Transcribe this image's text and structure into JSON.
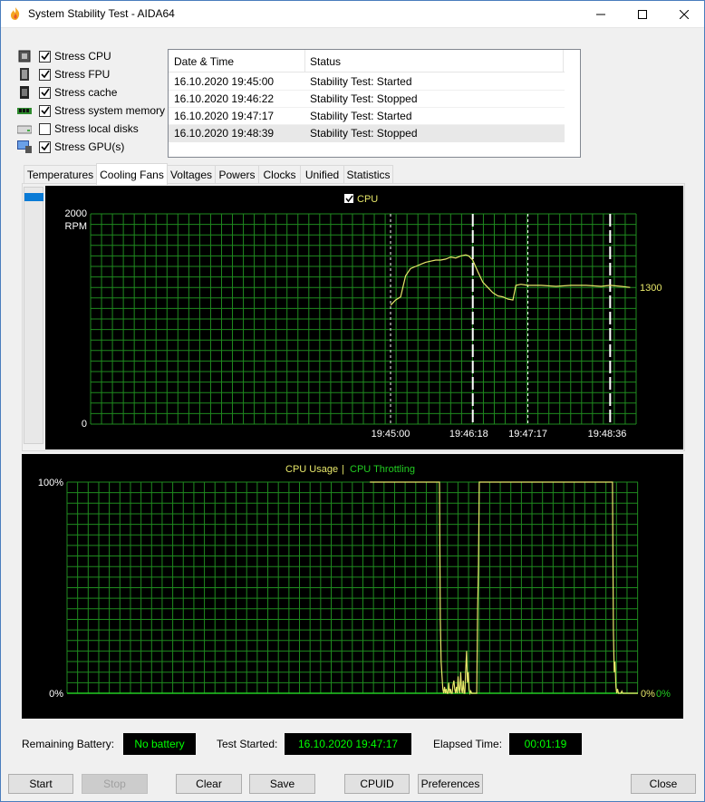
{
  "window": {
    "title": "System Stability Test - AIDA64"
  },
  "stress_options": [
    {
      "label": "Stress CPU",
      "checked": true,
      "icon": "cpu-chip-icon"
    },
    {
      "label": "Stress FPU",
      "checked": true,
      "icon": "fpu-chip-icon"
    },
    {
      "label": "Stress cache",
      "checked": true,
      "icon": "cache-chip-icon"
    },
    {
      "label": "Stress system memory",
      "checked": true,
      "icon": "memory-module-icon"
    },
    {
      "label": "Stress local disks",
      "checked": false,
      "icon": "disk-drive-icon"
    },
    {
      "label": "Stress GPU(s)",
      "checked": true,
      "icon": "monitor-gpu-icon"
    }
  ],
  "log": {
    "headers": [
      "Date & Time",
      "Status"
    ],
    "rows": [
      {
        "datetime": "16.10.2020 19:45:00",
        "status": "Stability Test: Started"
      },
      {
        "datetime": "16.10.2020 19:46:22",
        "status": "Stability Test: Stopped"
      },
      {
        "datetime": "16.10.2020 19:47:17",
        "status": "Stability Test: Started"
      },
      {
        "datetime": "16.10.2020 19:48:39",
        "status": "Stability Test: Stopped"
      }
    ]
  },
  "tabs": [
    {
      "label": "Temperatures",
      "active": false
    },
    {
      "label": "Cooling Fans",
      "active": true
    },
    {
      "label": "Voltages",
      "active": false
    },
    {
      "label": "Powers",
      "active": false
    },
    {
      "label": "Clocks",
      "active": false
    },
    {
      "label": "Unified",
      "active": false
    },
    {
      "label": "Statistics",
      "active": false
    }
  ],
  "chart_data": [
    {
      "type": "line",
      "legend": [
        "CPU"
      ],
      "legend_checked": true,
      "y_max_label": "2000",
      "y_unit": "RPM",
      "y_min_label": "0",
      "ylim": [
        0,
        2000
      ],
      "x_tick_labels": [
        "19:45:00",
        "19:46:18",
        "19:47:17",
        "19:48:36"
      ],
      "current_value_label": "1300",
      "series": [
        {
          "name": "CPU",
          "color": "#e8e86a",
          "points": [
            [
              "19:45:00",
              1130
            ],
            [
              "19:45:05",
              1180
            ],
            [
              "19:45:10",
              1210
            ],
            [
              "19:45:15",
              1410
            ],
            [
              "19:45:20",
              1480
            ],
            [
              "19:45:25",
              1500
            ],
            [
              "19:45:30",
              1520
            ],
            [
              "19:45:35",
              1540
            ],
            [
              "19:45:40",
              1550
            ],
            [
              "19:45:45",
              1560
            ],
            [
              "19:45:50",
              1560
            ],
            [
              "19:45:55",
              1570
            ],
            [
              "19:46:00",
              1590
            ],
            [
              "19:46:05",
              1580
            ],
            [
              "19:46:10",
              1600
            ],
            [
              "19:46:15",
              1610
            ],
            [
              "19:46:18",
              1600
            ],
            [
              "19:46:22",
              1560
            ],
            [
              "19:46:27",
              1450
            ],
            [
              "19:46:32",
              1350
            ],
            [
              "19:46:37",
              1300
            ],
            [
              "19:46:42",
              1250
            ],
            [
              "19:46:47",
              1220
            ],
            [
              "19:46:52",
              1210
            ],
            [
              "19:46:57",
              1190
            ],
            [
              "19:47:02",
              1180
            ],
            [
              "19:47:05",
              1320
            ],
            [
              "19:47:10",
              1330
            ],
            [
              "19:47:17",
              1320
            ],
            [
              "19:47:30",
              1320
            ],
            [
              "19:47:45",
              1310
            ],
            [
              "19:48:00",
              1320
            ],
            [
              "19:48:15",
              1320
            ],
            [
              "19:48:30",
              1310
            ],
            [
              "19:48:39",
              1320
            ],
            [
              "19:48:50",
              1310
            ],
            [
              "19:48:59",
              1300
            ]
          ]
        }
      ],
      "event_markers": [
        "19:45:00",
        "19:46:22",
        "19:47:17",
        "19:48:39"
      ],
      "grid": true
    },
    {
      "type": "line",
      "legend": [
        "CPU Usage",
        "CPU Throttling"
      ],
      "legend_colors": [
        "#e8e86a",
        "#22cc22"
      ],
      "y_max_label": "100%",
      "y_min_label": "0%",
      "ylim": [
        0,
        100
      ],
      "current_value_labels": [
        "0%",
        "0%"
      ],
      "series": [
        {
          "name": "CPU Usage",
          "color": "#e8e86a",
          "values": [
            0,
            0,
            0,
            0,
            0,
            0,
            0,
            0,
            0,
            0,
            0,
            0,
            0,
            0,
            0,
            0,
            0,
            0,
            0,
            0,
            0,
            0,
            0,
            0,
            0,
            0,
            0,
            0,
            0,
            0,
            0,
            0,
            0,
            0,
            0,
            0,
            0,
            0,
            0,
            0,
            0,
            0,
            0,
            0,
            0,
            0,
            0,
            0,
            0,
            0,
            0,
            0,
            0,
            0,
            0,
            0,
            0,
            0,
            0,
            0,
            0,
            0,
            0,
            0,
            0,
            0,
            0,
            0,
            0,
            0,
            0,
            0,
            0,
            0,
            0,
            0,
            0,
            0,
            0,
            0,
            0,
            0,
            0,
            0,
            0,
            0,
            0,
            0,
            0,
            0,
            0,
            0,
            0,
            0,
            0,
            0,
            0,
            0,
            0,
            0,
            0,
            0,
            0,
            0,
            0,
            0,
            0,
            0,
            0,
            0,
            0,
            0,
            0,
            0,
            0,
            0,
            0,
            0,
            0,
            0,
            0,
            0,
            0,
            0,
            0,
            0,
            0,
            0,
            0,
            0,
            0,
            0,
            0,
            0,
            0,
            0,
            0,
            0,
            0,
            0,
            0,
            0,
            0,
            0,
            0,
            0,
            0,
            0,
            0,
            0,
            0,
            0,
            0,
            0,
            0,
            0,
            0,
            0,
            0,
            0,
            0,
            0,
            0,
            0,
            0,
            0,
            0,
            0,
            0,
            0,
            0,
            0,
            0,
            0,
            0,
            0,
            0,
            0,
            0,
            0,
            0,
            0,
            0,
            0,
            0,
            0,
            0,
            0,
            0,
            0,
            0,
            0,
            0,
            0,
            0,
            0,
            0,
            0,
            0,
            0,
            0,
            0,
            0,
            0,
            0,
            0,
            0,
            0,
            0,
            0,
            0,
            0,
            0,
            0,
            0,
            0,
            0,
            0,
            0,
            0,
            0,
            0,
            0,
            0,
            0,
            0,
            0,
            0,
            0,
            0,
            0,
            0,
            0,
            0,
            0,
            0,
            0,
            0,
            0,
            0,
            0,
            0,
            0,
            0,
            0,
            0,
            0,
            0,
            0,
            0,
            0,
            0,
            0,
            0,
            0,
            0,
            0,
            0,
            0,
            0,
            0,
            0,
            0,
            0,
            0,
            0,
            0,
            0,
            0,
            0,
            0,
            0,
            0,
            0,
            0,
            0,
            0,
            0,
            0,
            0,
            0,
            0,
            0,
            0,
            0,
            0,
            0,
            0,
            0,
            0,
            0,
            0,
            0,
            0,
            0,
            0,
            0,
            0,
            0,
            0,
            0,
            0,
            0,
            0,
            0,
            0,
            0,
            0,
            0,
            0,
            0,
            0,
            0,
            0,
            0,
            0,
            0,
            0,
            0,
            0,
            0,
            0,
            0,
            0,
            0,
            0,
            0,
            0,
            0,
            0,
            0,
            0,
            0,
            0,
            0,
            0,
            0,
            0,
            0,
            0,
            0,
            0,
            0,
            0,
            0,
            0,
            0,
            0,
            0,
            0,
            2,
            8,
            0,
            100,
            100,
            100,
            100,
            100,
            100,
            100,
            100,
            100,
            100,
            100,
            100,
            100,
            100,
            100,
            100,
            100,
            100,
            100,
            100,
            100,
            100,
            100,
            100,
            100,
            100,
            100,
            100,
            100,
            100,
            100,
            100,
            100,
            100,
            100,
            100,
            100,
            100,
            100,
            100,
            100,
            100,
            100,
            100,
            100,
            100,
            100,
            100,
            100,
            100,
            100,
            100,
            100,
            100,
            100,
            100,
            100,
            100,
            100,
            100,
            100,
            100,
            100,
            100,
            100,
            100,
            100,
            100,
            100,
            100,
            100,
            100,
            100,
            100,
            100,
            100,
            100,
            100,
            100,
            100,
            100,
            100,
            100,
            100,
            100,
            100,
            100,
            35,
            15,
            8,
            2,
            0,
            3,
            0,
            2,
            0,
            0,
            5,
            0,
            2,
            0,
            0,
            4,
            6,
            2,
            0,
            3,
            0,
            8,
            2,
            0,
            10,
            2,
            0,
            6,
            0,
            0,
            12,
            20,
            5,
            10,
            2,
            0,
            1,
            0,
            0,
            0,
            0,
            0,
            0,
            0,
            40,
            60,
            100,
            100,
            100,
            100,
            100,
            100,
            100,
            100,
            100,
            100,
            100,
            100,
            100,
            100,
            100,
            100,
            100,
            100,
            100,
            100,
            100,
            100,
            100,
            100,
            100,
            100,
            100,
            100,
            100,
            100,
            100,
            100,
            100,
            100,
            100,
            100,
            100,
            100,
            100,
            100,
            100,
            100,
            100,
            100,
            100,
            100,
            100,
            100,
            100,
            100,
            100,
            100,
            100,
            100,
            100,
            100,
            100,
            100,
            100,
            100,
            100,
            100,
            100,
            100,
            100,
            100,
            100,
            100,
            100,
            100,
            100,
            100,
            100,
            100,
            100,
            100,
            100,
            100,
            100,
            100,
            100,
            100,
            100,
            100,
            100,
            100,
            100,
            100,
            100,
            100,
            100,
            100,
            100,
            100,
            100,
            100,
            100,
            100,
            100,
            100,
            100,
            100,
            100,
            100,
            100,
            100,
            100,
            100,
            100,
            100,
            100,
            100,
            100,
            100,
            100,
            100,
            100,
            100,
            100,
            100,
            100,
            100,
            100,
            100,
            100,
            100,
            100,
            100,
            100,
            100,
            100,
            100,
            100,
            100,
            100,
            100,
            100,
            100,
            100,
            100,
            100,
            100,
            100,
            100,
            100,
            100,
            100,
            100,
            100,
            100,
            100,
            100,
            100,
            100,
            100,
            100,
            100,
            100,
            30,
            10,
            15,
            3,
            0,
            2,
            0,
            0,
            0,
            0,
            1,
            0,
            0,
            0,
            0,
            0,
            0,
            0,
            0,
            0,
            0,
            0,
            0,
            0,
            0,
            0,
            0,
            0,
            0,
            0
          ]
        },
        {
          "name": "CPU Throttling",
          "color": "#22cc22",
          "values_constant": 0
        }
      ],
      "grid": true
    }
  ],
  "status": {
    "battery_label": "Remaining Battery:",
    "battery_value": "No battery",
    "started_label": "Test Started:",
    "started_value": "16.10.2020 19:47:17",
    "elapsed_label": "Elapsed Time:",
    "elapsed_value": "00:01:19"
  },
  "buttons": {
    "start": {
      "label": "Start",
      "enabled": true
    },
    "stop": {
      "label": "Stop",
      "enabled": false
    },
    "clear": {
      "label": "Clear",
      "enabled": true
    },
    "save": {
      "label": "Save",
      "enabled": true
    },
    "cpuid": {
      "label": "CPUID",
      "enabled": true
    },
    "preferences": {
      "label": "Preferences",
      "enabled": true
    },
    "close": {
      "label": "Close",
      "enabled": true
    }
  },
  "colors": {
    "grid": "#1f8a1f",
    "graph_bg": "#000000",
    "cpu_line": "#e8e86a",
    "throttle_line": "#22cc22",
    "info_text": "#00ff00",
    "selection": "#0a7bd6"
  }
}
